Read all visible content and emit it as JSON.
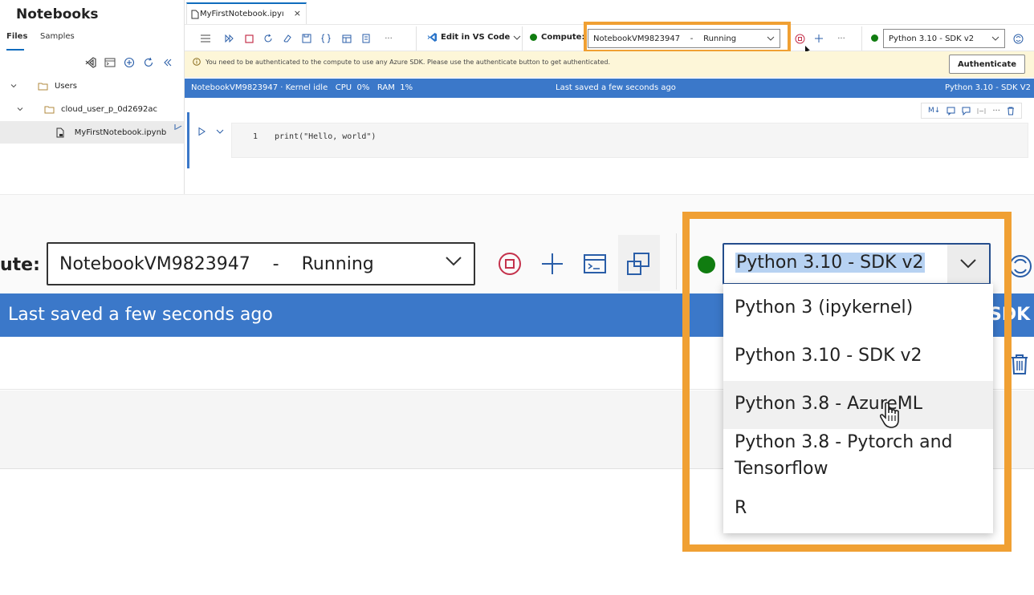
{
  "sidebar": {
    "title": "Notebooks",
    "tabs": [
      {
        "label": "Files"
      },
      {
        "label": "Samples"
      }
    ],
    "tree": [
      {
        "label": "Users"
      },
      {
        "label": "cloud_user_p_0d2692ac"
      },
      {
        "label": "MyFirstNotebook.ipynb"
      }
    ]
  },
  "tab": {
    "label": "MyFirstNotebook.ipyı",
    "close": "×"
  },
  "toolbar": {
    "vscode_label": "Edit in VS Code",
    "compute_label": "Compute:",
    "compute_value": "NotebookVM9823947    -    Running",
    "kernel_value": "Python 3.10 - SDK v2",
    "more": "···"
  },
  "auth": {
    "message": "You need to be authenticated to the compute to use any Azure SDK. Please use the authenticate button to get authenticated.",
    "button": "Authenticate"
  },
  "status": {
    "left": "NotebookVM9823947 · Kernel idle   CPU  0%   RAM  1%",
    "middle": "Last saved a few seconds ago",
    "right": "Python 3.10 - SDK V2"
  },
  "cell": {
    "line_number": "1",
    "code": "print(\"Hello, world\")",
    "tool_md": "M↓"
  },
  "zoom": {
    "compute_label": "ute:",
    "compute_value": "NotebookVM9823947    -    Running",
    "kernel_value": "Python 3.10 - SDK v2",
    "status_text": "Last saved a few seconds ago",
    "status_right": "SDK V",
    "kernel_options": [
      {
        "label": "Python 3 (ipykernel)"
      },
      {
        "label": "Python 3.10 - SDK v2"
      },
      {
        "label": "Python 3.8 - AzureML"
      },
      {
        "label": "Python 3.8 - Pytorch and",
        "label2": "Tensorflow"
      },
      {
        "label": "R"
      }
    ]
  },
  "colors": {
    "accent": "#0f6cbd",
    "status_bar": "#3b78c9",
    "highlight_orange": "#f0a033",
    "running_green": "#107c10",
    "auth_banner": "#fdf6d8"
  }
}
